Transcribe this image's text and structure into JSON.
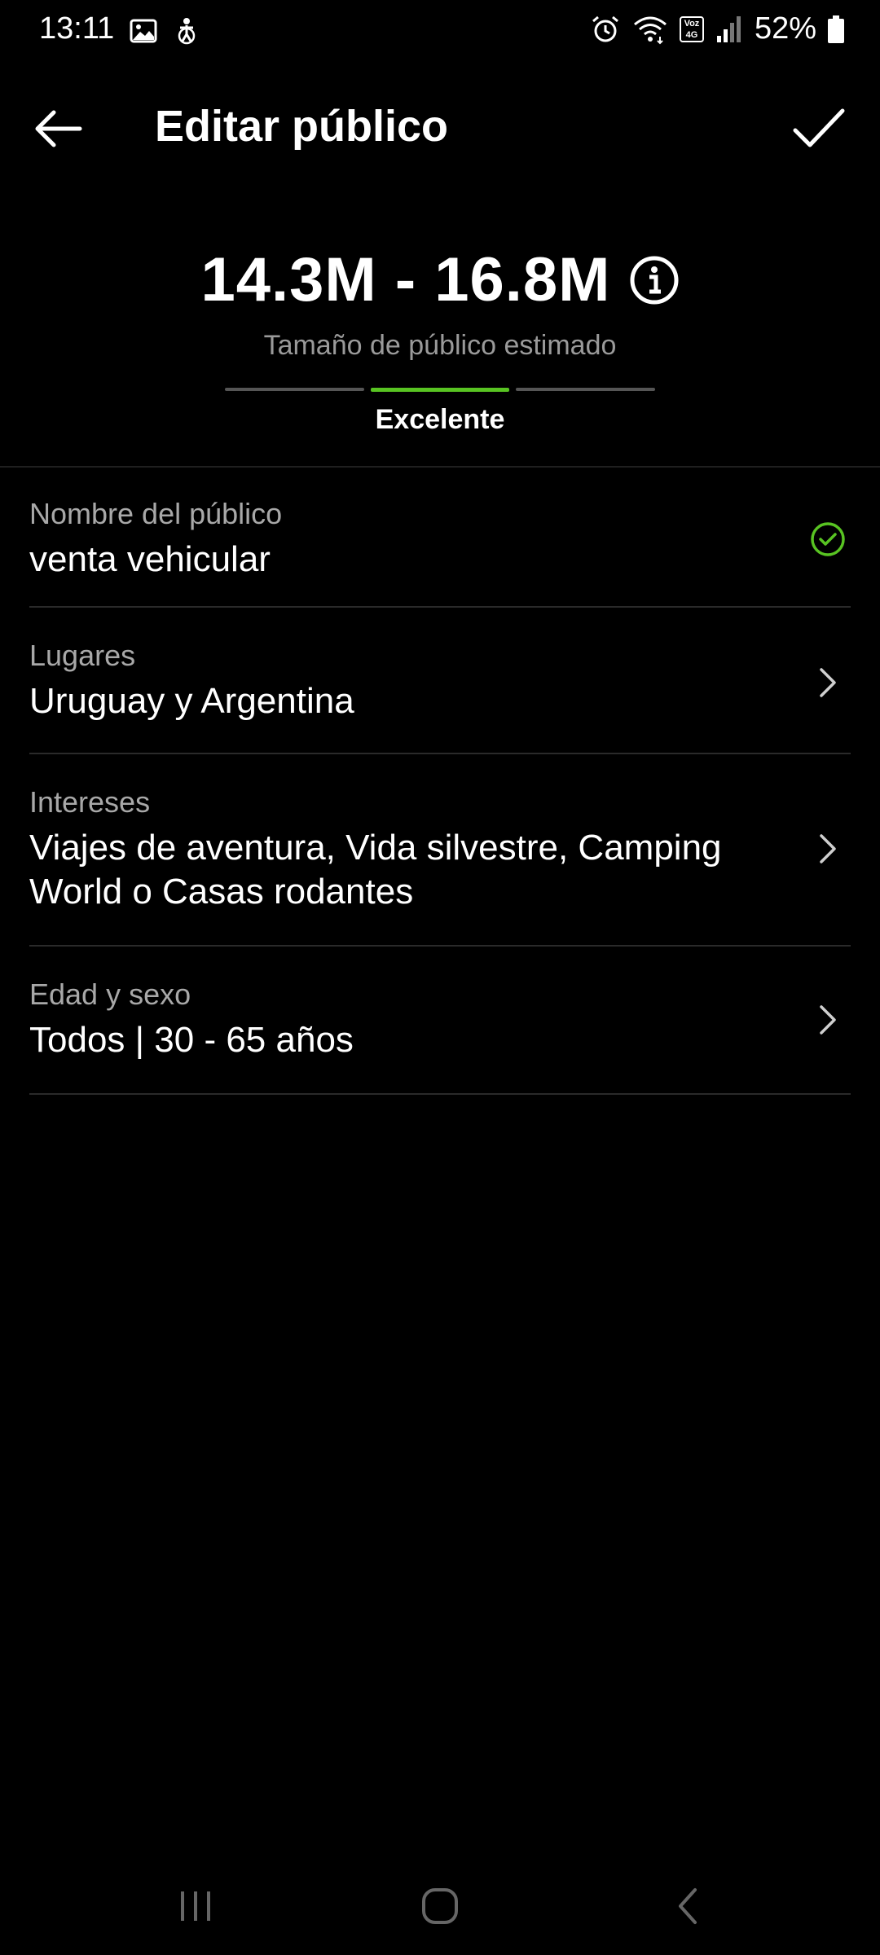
{
  "status_bar": {
    "time": "13:11",
    "battery_percent": "52%",
    "network_badge_top": "Voz",
    "network_badge_bottom": "4G"
  },
  "header": {
    "title": "Editar público"
  },
  "audience": {
    "size_range": "14.3M - 16.8M",
    "size_label": "Tamaño de público estimado",
    "quality_label": "Excelente",
    "quality_level": "2 of 3",
    "accent_color": "#58c322"
  },
  "rows": [
    {
      "label": "Nombre del público",
      "value": "venta vehicular",
      "icon": "check-circle-icon"
    },
    {
      "label": "Lugares",
      "value": "Uruguay y Argentina",
      "icon": "chevron-right-icon"
    },
    {
      "label": "Intereses",
      "value": "Viajes de aventura, Vida silvestre, Camping World o Casas rodantes",
      "icon": "chevron-right-icon"
    },
    {
      "label": "Edad y sexo",
      "value": "Todos | 30 - 65 años",
      "icon": "chevron-right-icon"
    }
  ]
}
